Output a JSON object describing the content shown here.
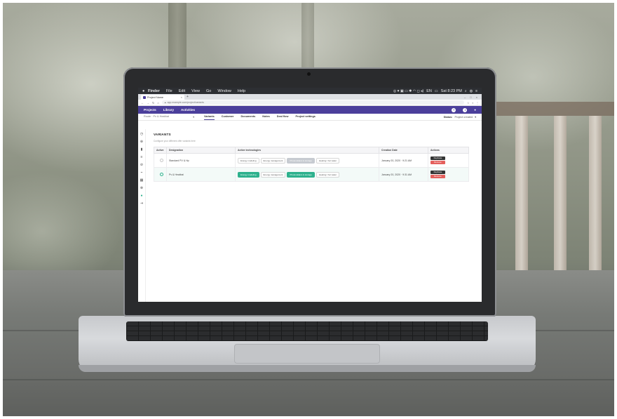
{
  "menubar": {
    "items": [
      "Finder",
      "File",
      "Edit",
      "View",
      "Go",
      "Window",
      "Help"
    ],
    "clock": "Sat 8:23 PM",
    "lang": "EN"
  },
  "browser": {
    "tab_title": "Project Name",
    "tab_close": "×",
    "new_tab": "+",
    "url": "app.example.com/project/variants",
    "window_controls": [
      "–",
      "□",
      "×"
    ]
  },
  "app": {
    "nav": [
      "Projects",
      "Library",
      "Activities"
    ],
    "help_glyph": "?",
    "info_glyph": "i",
    "user_glyph": "●"
  },
  "subnav": {
    "variant_select": "Route · Pv & Heatbat",
    "select_arrow": "▾",
    "links": [
      "Variants",
      "Customer",
      "Documents",
      "Notes",
      "Deal flow",
      "Project settings"
    ],
    "active_link": "Variants",
    "status_label": "Status:",
    "status_value": "Project created",
    "status_arrow": "▾"
  },
  "sidebar": {
    "icons": [
      "◷",
      "⊕",
      "▮",
      "≡",
      "⊘",
      "⌁",
      "▦",
      "⊗",
      "●",
      "⇥"
    ]
  },
  "page": {
    "title": "VARIANTS",
    "subtitle": "Configure your different offer variants here"
  },
  "table": {
    "headers": [
      "Active",
      "Designation",
      "Active technologies",
      "Creation Date",
      "Actions"
    ],
    "rows": [
      {
        "active": false,
        "designation": "Standard PV & Hp",
        "techs": [
          {
            "label": "Energy modeling",
            "style": "outline"
          },
          {
            "label": "Energy management",
            "style": "outline"
          },
          {
            "label": "Photovoltaics & storage",
            "style": "grey"
          },
          {
            "label": "Heating / hot water",
            "style": "outline"
          }
        ],
        "date": "January 20, 2020 · 9:21 AM",
        "duplicate": "Duplicate",
        "remove": "Remove"
      },
      {
        "active": true,
        "designation": "Pv & Heatbat",
        "techs": [
          {
            "label": "Energy modeling",
            "style": "green"
          },
          {
            "label": "Energy management",
            "style": "outline"
          },
          {
            "label": "Photovoltaics & storage",
            "style": "green"
          },
          {
            "label": "Heating / hot water",
            "style": "outline"
          }
        ],
        "date": "January 20, 2020 · 9:31 AM",
        "duplicate": "Duplicate",
        "remove": "Remove"
      }
    ]
  },
  "colors": {
    "brand": "#4b3f9b",
    "accent_green": "#2db18d",
    "remove_red": "#e4605d"
  }
}
